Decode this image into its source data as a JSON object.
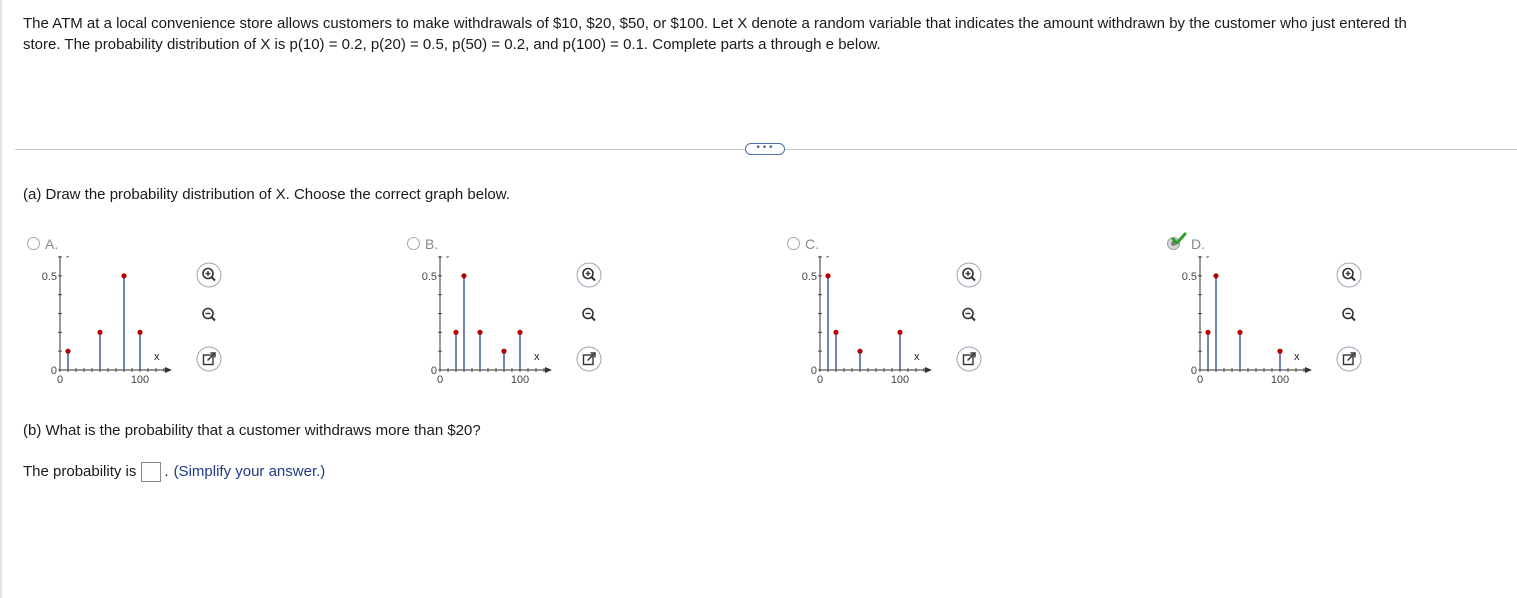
{
  "problem": {
    "line1": "The ATM at a local convenience store allows customers to make withdrawals of $10, $20, $50, or $100. Let X denote a random variable that indicates the amount withdrawn by the customer who just entered th",
    "line2": "store. The probability distribution of X is p(10) = 0.2, p(20) = 0.5, p(50) = 0.2, and p(100) = 0.1. Complete parts a through e below."
  },
  "more_button": "•••",
  "part_a": {
    "question": "(a) Draw the probability distribution of X. Choose the correct graph below.",
    "selected": "D",
    "options": [
      {
        "letter": "A.",
        "y_label": "y",
        "x_label": "x",
        "y_ticks": [
          "0.5",
          "0"
        ],
        "x_ticks": [
          "0",
          "100"
        ],
        "chart_data": {
          "type": "bar",
          "x": [
            10,
            50,
            80,
            100
          ],
          "y": [
            0.1,
            0.2,
            0.5,
            0.2
          ],
          "xlim": [
            0,
            130
          ],
          "ylim": [
            0,
            0.6
          ]
        }
      },
      {
        "letter": "B.",
        "y_label": "y",
        "x_label": "x",
        "y_ticks": [
          "0.5",
          "0"
        ],
        "x_ticks": [
          "0",
          "100"
        ],
        "chart_data": {
          "type": "bar",
          "x": [
            20,
            30,
            50,
            80,
            100
          ],
          "y": [
            0.2,
            0.5,
            0.2,
            0.1,
            0.2
          ],
          "xlim": [
            0,
            130
          ],
          "ylim": [
            0,
            0.6
          ]
        }
      },
      {
        "letter": "C.",
        "y_label": "y",
        "x_label": "x",
        "y_ticks": [
          "0.5",
          "0"
        ],
        "x_ticks": [
          "0",
          "100"
        ],
        "chart_data": {
          "type": "bar",
          "x": [
            10,
            20,
            50,
            100
          ],
          "y": [
            0.5,
            0.2,
            0.1,
            0.2
          ],
          "xlim": [
            0,
            130
          ],
          "ylim": [
            0,
            0.6
          ]
        }
      },
      {
        "letter": "D.",
        "y_label": "y",
        "x_label": "x",
        "y_ticks": [
          "0.5",
          "0"
        ],
        "x_ticks": [
          "0",
          "100"
        ],
        "chart_data": {
          "type": "bar",
          "x": [
            10,
            20,
            50,
            100
          ],
          "y": [
            0.2,
            0.5,
            0.2,
            0.1
          ],
          "xlim": [
            0,
            130
          ],
          "ylim": [
            0,
            0.6
          ]
        }
      }
    ]
  },
  "part_b": {
    "question": "(b) What is the probability that a customer withdraws more than $20?",
    "answer_prefix": "The probability is",
    "answer_value": "",
    "answer_suffix": ".",
    "hint": "(Simplify your answer.)"
  },
  "colors": {
    "stem": "#2b3f9a",
    "dot": "#b30000",
    "check": "#2e9e2e",
    "hint": "#1f3a8a",
    "tool_border": "#9aa6b5"
  },
  "icons": [
    "zoom-in-icon",
    "zoom-out-icon",
    "popout-icon",
    "checkmark-icon"
  ]
}
